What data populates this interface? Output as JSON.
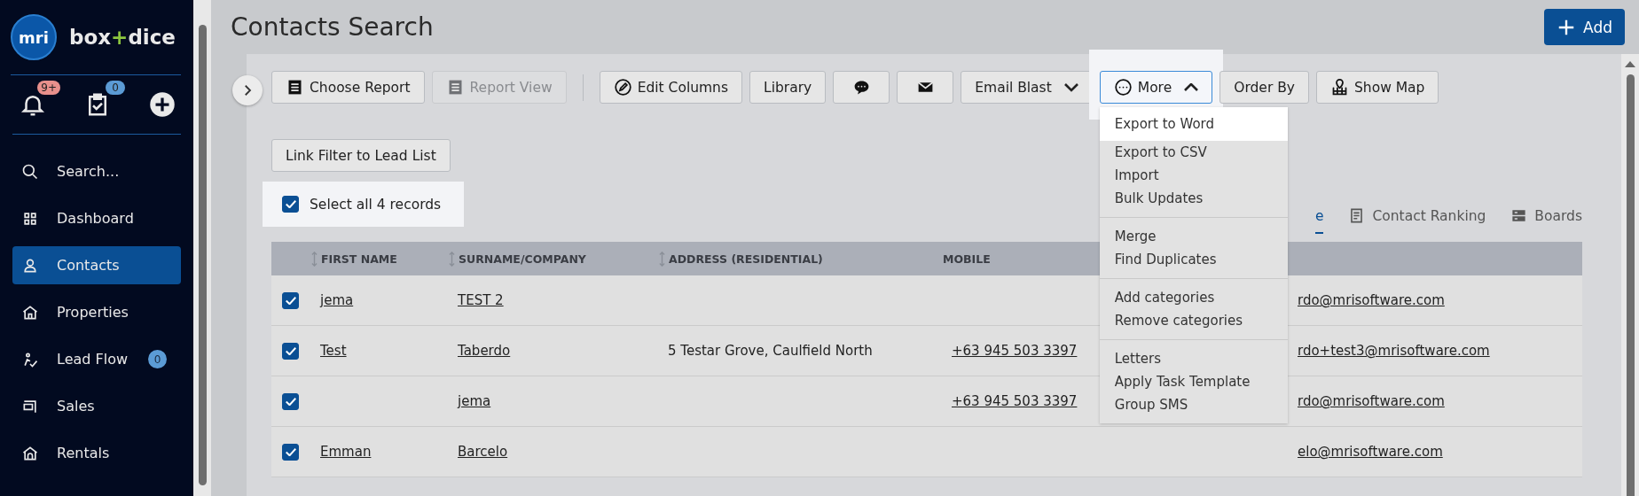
{
  "sidebar": {
    "logo": "mri",
    "brand": [
      "box",
      "+",
      "dice"
    ],
    "quick_actions": [
      {
        "kind": "bell",
        "badge": "9+",
        "color": "#e8908c"
      },
      {
        "kind": "tasks",
        "badge": "0",
        "color": "#5b9bd5"
      },
      {
        "kind": "add"
      }
    ],
    "nav": [
      {
        "label": "Search...",
        "kind": "search",
        "selected": false
      },
      {
        "label": "Dashboard",
        "kind": "grid",
        "selected": false
      },
      {
        "label": "Contacts",
        "kind": "person",
        "selected": true
      },
      {
        "label": "Properties",
        "kind": "house",
        "selected": false
      },
      {
        "label": "Lead Flow",
        "kind": "leadflow",
        "selected": false,
        "badge": "0"
      },
      {
        "label": "Sales",
        "kind": "sales",
        "selected": false
      },
      {
        "label": "Rentals",
        "kind": "rentals",
        "selected": false
      }
    ]
  },
  "header": {
    "title": "Contacts Search",
    "add_button": "Add"
  },
  "toolbar": {
    "groups": [
      [
        {
          "label": "Choose Report",
          "kind": "report",
          "disabled": false
        },
        {
          "label": "Report View",
          "kind": "report",
          "disabled": true
        }
      ],
      [
        {
          "label": "Edit Columns",
          "kind": "edit",
          "disabled": false
        },
        {
          "label": "Library",
          "kind": "text",
          "disabled": false
        },
        {
          "kind": "chat",
          "disabled": false
        },
        {
          "kind": "mail",
          "disabled": false
        },
        {
          "label": "Email Blast",
          "kind": "text",
          "disabled": false,
          "expanded": false
        },
        {
          "label": "More",
          "kind": "dots",
          "disabled": false,
          "expanded": true
        },
        {
          "label": "Order By",
          "kind": "text",
          "disabled": false
        },
        {
          "label": "Show Map",
          "kind": "map",
          "disabled": false
        }
      ],
      [
        {
          "label": "Link Filter to Lead List",
          "kind": "text",
          "disabled": false
        }
      ]
    ]
  },
  "more_menu": [
    [
      {
        "label": "Export to Word",
        "highlighted": true
      },
      {
        "label": "Export to CSV",
        "highlighted": false
      },
      {
        "label": "Import",
        "highlighted": false
      },
      {
        "label": "Bulk Updates",
        "highlighted": false
      }
    ],
    [
      {
        "label": "Merge",
        "highlighted": false
      },
      {
        "label": "Find Duplicates",
        "highlighted": false
      }
    ],
    [
      {
        "label": "Add categories",
        "highlighted": false
      },
      {
        "label": "Remove categories",
        "highlighted": false
      }
    ],
    [
      {
        "label": "Letters",
        "highlighted": false
      },
      {
        "label": "Apply Task Template",
        "highlighted": false
      },
      {
        "label": "Group SMS",
        "highlighted": false
      }
    ]
  ],
  "select_all": {
    "label": "Select all 4 records",
    "checked": true
  },
  "view_tabs": [
    {
      "label": "e",
      "kind": "text",
      "selected": true
    },
    {
      "label": "Contact Ranking",
      "kind": "list",
      "selected": false
    },
    {
      "label": "Boards",
      "kind": "boards",
      "selected": false
    }
  ],
  "table": {
    "columns": [
      {
        "label": "FIRST NAME",
        "sortable": true
      },
      {
        "label": "SURNAME/COMPANY",
        "sortable": true
      },
      {
        "label": "ADDRESS (RESIDENTIAL)",
        "sortable": true
      },
      {
        "label": "MOBILE",
        "sortable": false
      }
    ],
    "rows": [
      {
        "checked": true,
        "first_name": "jema",
        "surname": "TEST 2",
        "email": "rdo@mrisoftware.com"
      },
      {
        "checked": true,
        "first_name": "Test",
        "surname": "Taberdo",
        "address": "5 Testar Grove, Caulfield North",
        "mobile": "+63 945 503 3397",
        "email": "rdo+test3@mrisoftware.com"
      },
      {
        "checked": true,
        "surname": "jema",
        "mobile": "+63 945 503 3397",
        "email": "rdo@mrisoftware.com"
      },
      {
        "checked": true,
        "first_name": "Emman",
        "surname": "Barcelo",
        "email": "elo@mrisoftware.com"
      }
    ]
  }
}
